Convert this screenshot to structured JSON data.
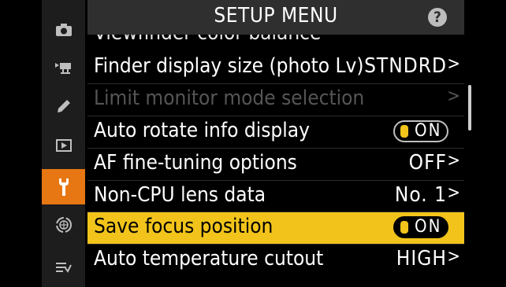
{
  "header": {
    "title": "SETUP MENU",
    "help_label": "?"
  },
  "sidebar": {
    "items": [
      {
        "name": "photo-shooting-menu-icon",
        "active": false
      },
      {
        "name": "movie-recording-menu-icon",
        "active": false
      },
      {
        "name": "custom-settings-menu-icon",
        "active": false
      },
      {
        "name": "playback-menu-icon",
        "active": false
      },
      {
        "name": "setup-menu-icon",
        "active": true
      },
      {
        "name": "network-menu-icon",
        "active": false
      },
      {
        "name": "my-menu-icon",
        "active": false
      }
    ]
  },
  "partial_item": "Viewfinder color balance",
  "menu": {
    "items": [
      {
        "label": "Finder display size (photo Lv)",
        "value": "STNDRD",
        "arrow": ">"
      },
      {
        "label": "Limit monitor mode selection",
        "value": "",
        "arrow": ">"
      },
      {
        "label": "Auto rotate info display",
        "toggle": "ON"
      },
      {
        "label": "AF fine-tuning options",
        "value": "OFF",
        "arrow": ">"
      },
      {
        "label": "Non-CPU lens data",
        "value": "No. 1",
        "arrow": ">"
      },
      {
        "label": "Save focus position",
        "toggle": "ON"
      },
      {
        "label": "Auto temperature cutout",
        "value": "HIGH",
        "arrow": ">"
      }
    ]
  },
  "colors": {
    "active_tab": "#e67712",
    "selected_row": "#f2c41b",
    "header_bg": "#2f2f2f",
    "sidebar_bg": "#1d1d1d"
  }
}
